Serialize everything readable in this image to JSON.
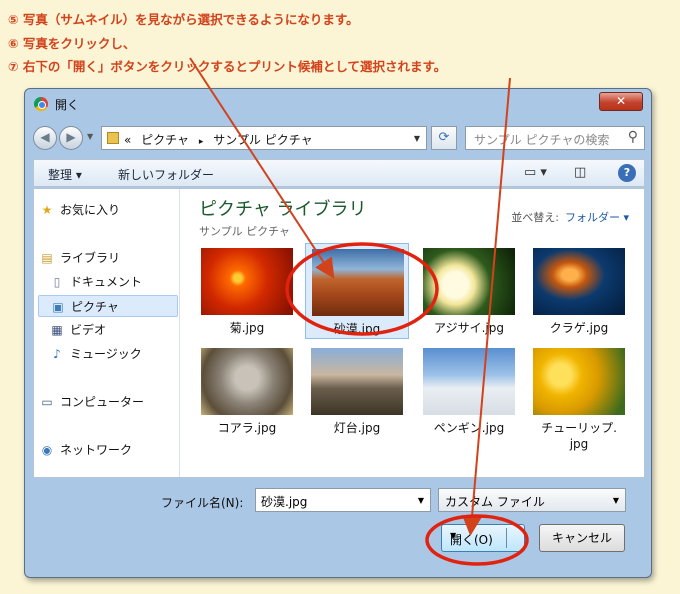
{
  "instructions": [
    "⑤ 写真（サムネイル）を見ながら選択できるようになります。",
    "⑥ 写真をクリックし、",
    "⑦ 右下の「開く」ボタンをクリックするとプリント候補として選択されます。"
  ],
  "dialog": {
    "title": "開く",
    "close_label": "✕",
    "address": {
      "prefix": "«",
      "crumbs": [
        "ピクチャ",
        "サンプル ピクチャ"
      ],
      "separator": "▸"
    },
    "search_placeholder": "サンプル ピクチャの検索",
    "toolbar": {
      "organize": "整理 ▾",
      "new_folder": "新しいフォルダー"
    },
    "sidebar": {
      "favorites": "お気に入り",
      "libraries": "ライブラリ",
      "documents": "ドキュメント",
      "pictures": "ピクチャ",
      "videos": "ビデオ",
      "music": "ミュージック",
      "computer": "コンピューター",
      "network": "ネットワーク"
    },
    "library": {
      "title": "ピクチャ ライブラリ",
      "subtitle": "サンプル ピクチャ",
      "arrange_label": "並べ替え:",
      "arrange_value": "フォルダー ▾"
    },
    "files": [
      {
        "name": "菊.jpg"
      },
      {
        "name": "砂漠.jpg"
      },
      {
        "name": "アジサイ.jpg"
      },
      {
        "name": "クラゲ.jpg"
      },
      {
        "name": "コアラ.jpg"
      },
      {
        "name": "灯台.jpg"
      },
      {
        "name": "ペンギン.jpg"
      },
      {
        "name": "チューリップ.\njpg"
      }
    ],
    "filename_label": "ファイル名(N):",
    "filename_value": "砂漠.jpg",
    "filter_value": "カスタム ファイル",
    "open_label": "開く(O)",
    "cancel_label": "キャンセル"
  },
  "colors": {
    "annotation": "#d2421b",
    "accent": "#3a6fb7"
  }
}
